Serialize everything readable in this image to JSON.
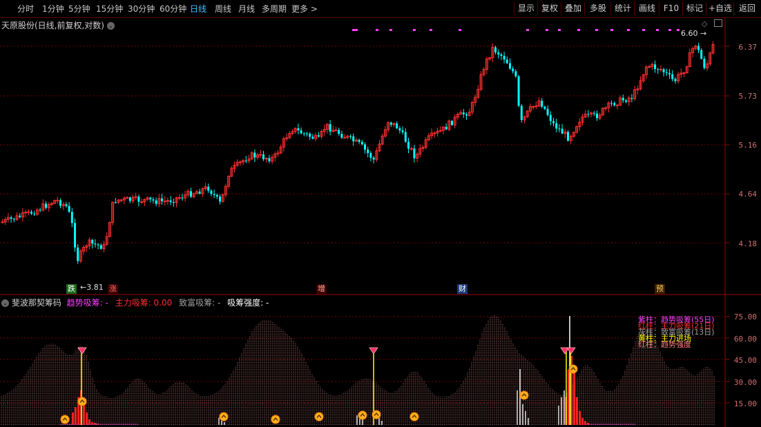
{
  "toolbar": {
    "periods": [
      "分时",
      "1分钟",
      "5分钟",
      "15分钟",
      "30分钟",
      "60分钟",
      "日线",
      "周线",
      "月线",
      "多周期",
      "更多 >"
    ],
    "active_period": "日线",
    "tools": [
      "显示",
      "复权",
      "叠加",
      "多股",
      "统计",
      "画线",
      "F10",
      "标记",
      "+自选",
      "返回"
    ]
  },
  "price_panel": {
    "title": "天原股份(日线,前复权,对数)",
    "high_label": "6.60",
    "low_label": "3.81",
    "y_labels": [
      "6.37",
      "5.73",
      "5.16",
      "4.64",
      "4.18"
    ],
    "events": [
      {
        "text": "跌",
        "color": "#ffffff",
        "bg": "#1a6a1a"
      },
      {
        "text": "涨",
        "color": "#ff7070",
        "bg": "#3a0000"
      },
      {
        "text": "增",
        "color": "#ffb0a0",
        "bg": "#3a0000"
      },
      {
        "text": "财",
        "color": "#ffffff",
        "bg": "#1a3a7a"
      },
      {
        "text": "预",
        "color": "#ffd060",
        "bg": "#3a2000"
      }
    ]
  },
  "indicator_panel": {
    "name": "斐波那契筹码",
    "fields": [
      {
        "label": "趋势吸筹: -",
        "color": "#ff40ff"
      },
      {
        "label": "主力吸筹: 0.00",
        "color": "#ff3030"
      },
      {
        "label": "致富吸筹: -",
        "color": "#a0a0a0"
      },
      {
        "label": "吸筹强度: -",
        "color": "#ffffff"
      }
    ],
    "y_labels": [
      "75.00",
      "60.00",
      "45.00",
      "30.00",
      "15.00"
    ],
    "legend": [
      {
        "text": "紫柱：趋势吸筹(55日)",
        "color": "#ff40ff"
      },
      {
        "text": "红柱：主力吸筹(21日)",
        "color": "#ff3030"
      },
      {
        "text": "灰柱：致富吸筹(13日)",
        "color": "#a0a0a0"
      },
      {
        "text": "黄柱：主力进场",
        "color": "#ffff00"
      },
      {
        "text": "红柱：趋势强度",
        "color": "#ff8080"
      }
    ]
  },
  "colors": {
    "up": "#ff3030",
    "down": "#00ffff",
    "grid": "#7a0000",
    "border": "#a00000"
  }
}
